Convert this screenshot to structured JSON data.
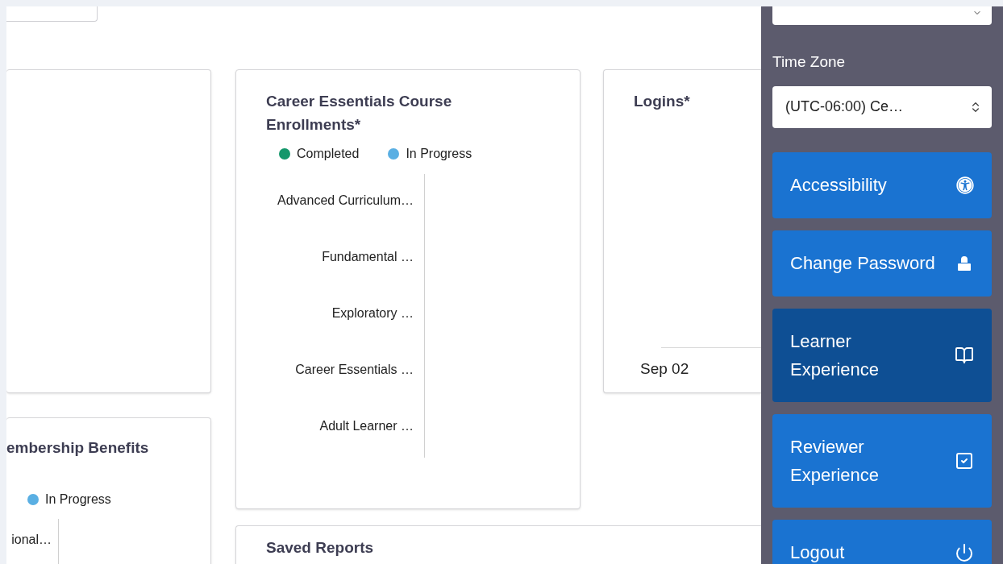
{
  "enrollments_card": {
    "title": "Career Essentials Course Enrollments*",
    "legend": [
      {
        "label": "Completed",
        "color": "#14976b"
      },
      {
        "label": "In Progress",
        "color": "#5aafe3"
      }
    ],
    "categories": [
      "Advanced Curriculum…",
      "Fundamental …",
      "Exploratory …",
      "Career Essentials …",
      "Adult Learner …"
    ]
  },
  "logins_card": {
    "title": "Logins*",
    "x_label": "Sep 02"
  },
  "membership_card": {
    "title": "embership Benefits",
    "legend": [
      {
        "label": "In Progress",
        "color": "#5aafe3"
      }
    ],
    "categories": [
      "ional…"
    ]
  },
  "saved_reports_card": {
    "title": "Saved Reports"
  },
  "side_panel": {
    "time_zone_label": "Time Zone",
    "time_zone_value": "(UTC-06:00) Ce…",
    "buttons": [
      {
        "label": "Accessibility",
        "kind": "accessibility",
        "selected": false
      },
      {
        "label": "Change Password",
        "kind": "lock",
        "selected": false
      },
      {
        "label": "Learner Experience",
        "kind": "book",
        "selected": true
      },
      {
        "label": "Reviewer Experience",
        "kind": "check",
        "selected": false
      },
      {
        "label": "Logout",
        "kind": "power",
        "selected": false
      }
    ]
  }
}
